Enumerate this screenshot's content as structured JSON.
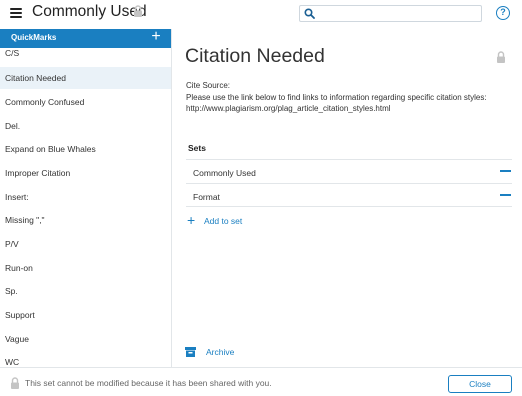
{
  "header": {
    "title": "Commonly Used",
    "search": {
      "value": "",
      "placeholder": ""
    },
    "help_label": "?"
  },
  "sidebar": {
    "header_label": "QuickMarks",
    "add_label": "+",
    "items": [
      {
        "label": "C/S",
        "selected": false
      },
      {
        "label": "Citation Needed",
        "selected": true
      },
      {
        "label": "Commonly Confused",
        "selected": false
      },
      {
        "label": "Del.",
        "selected": false
      },
      {
        "label": "Expand on Blue Whales",
        "selected": false
      },
      {
        "label": "Improper Citation",
        "selected": false
      },
      {
        "label": "Insert:",
        "selected": false
      },
      {
        "label": "Missing \",\"",
        "selected": false
      },
      {
        "label": "P/V",
        "selected": false
      },
      {
        "label": "Run-on",
        "selected": false
      },
      {
        "label": "Sp.",
        "selected": false
      },
      {
        "label": "Support",
        "selected": false
      },
      {
        "label": "Vague",
        "selected": false
      },
      {
        "label": "WC",
        "selected": false
      }
    ]
  },
  "main": {
    "title": "Citation Needed",
    "description": [
      "Cite Source:",
      "Please use the link below to find links to information regarding specific citation styles:",
      "http://www.plagiarism.org/plag_article_citation_styles.html"
    ],
    "sets_title": "Sets",
    "sets": [
      {
        "name": "Commonly Used"
      },
      {
        "name": "Format"
      }
    ],
    "add_to_set_label": "Add to set",
    "archive_label": "Archive"
  },
  "footer": {
    "message": "This set cannot be modified because it has been shared with you.",
    "close_label": "Close"
  },
  "colors": {
    "accent": "#1a7fc1",
    "selected_bg": "#eaf2f8",
    "divider": "#e2e6e9",
    "lock_gray": "#c4c4c4"
  }
}
